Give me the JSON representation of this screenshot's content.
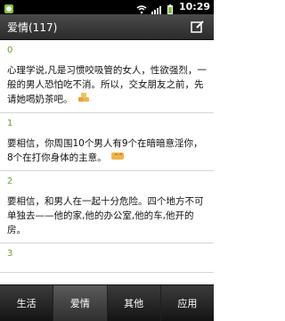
{
  "status": {
    "time": "10:29",
    "icons": [
      "app-notification-icon",
      "wifi-icon",
      "signal-icon",
      "battery-icon"
    ]
  },
  "title": "爱情(117)",
  "items": [
    {
      "index": "0",
      "text": "心理学说,凡是习惯咬吸管的女人，性欲强烈，一般的男人恐怕吃不消。所以，交女朋友之前，先请她喝奶茶吧。"
    },
    {
      "index": "1",
      "text": "要相信，你周围10个男人有9个在暗暗意淫你，8个在打你身体的主意。"
    },
    {
      "index": "2",
      "text": "要相信，和男人在一起十分危险。四个地方不可单独去——他的家,他的办公室,他的车,他开的房。"
    },
    {
      "index": "3",
      "text": ""
    }
  ],
  "tabs": {
    "t1": "生活",
    "t2": "爱情",
    "t3": "其他",
    "t4": "应用"
  }
}
